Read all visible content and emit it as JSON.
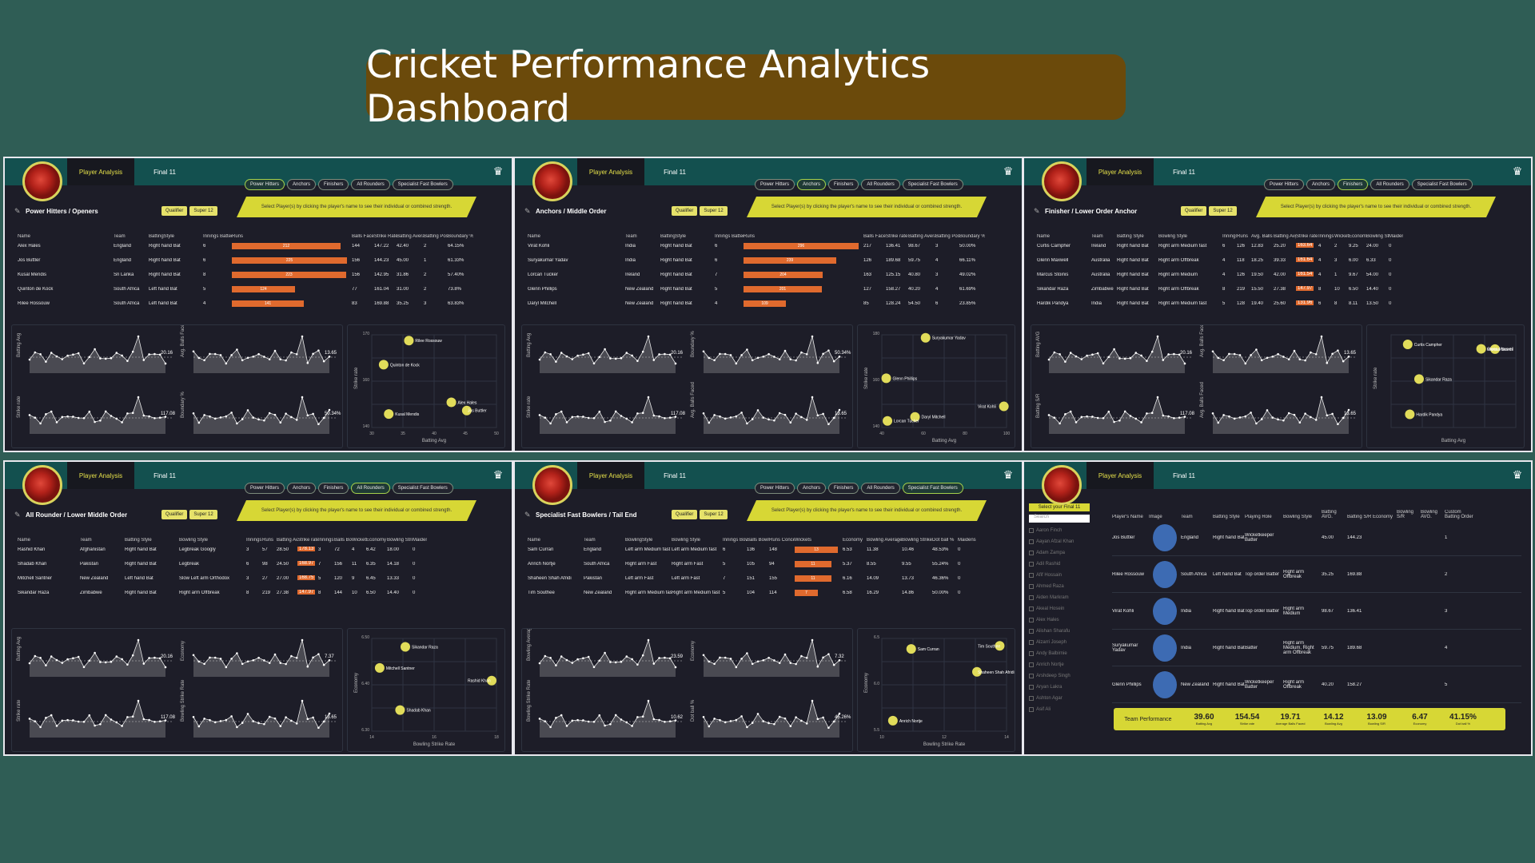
{
  "title": "Cricket Performance Analytics Dashboard",
  "common": {
    "player_analysis": "Player Analysis",
    "final11": "Final 11",
    "tabs": [
      "Power Hitters",
      "Anchors",
      "Finishers",
      "All Rounders",
      "Specialist Fast Bowlers"
    ],
    "qualifier": "Qualifier",
    "super": "Super 12",
    "banner": "Select Player(s) by clicking the player's name to see their individual or combined strength."
  },
  "p1": {
    "section": "Power Hitters / Openers",
    "cols": [
      "Name",
      "Team",
      "BattingStyle",
      "Innings Batted",
      "Runs",
      "Balls Faced",
      "Strike Rate",
      "Batting Average",
      "Batting Position",
      "Boundary %"
    ],
    "rows": [
      [
        "Alex Hales",
        "England",
        "Right hand Bat",
        "6",
        "212",
        "144",
        "147.22",
        "42.40",
        "2",
        "64.15%"
      ],
      [
        "Jos Buttler",
        "England",
        "Right hand Bat",
        "6",
        "225",
        "156",
        "144.23",
        "45.00",
        "1",
        "61.33%"
      ],
      [
        "Kusal Mendis",
        "Sri Lanka",
        "Right hand Bat",
        "8",
        "223",
        "156",
        "142.95",
        "31.86",
        "2",
        "57.40%"
      ],
      [
        "Quinton de Kock",
        "South Africa",
        "Left hand Bat",
        "5",
        "124",
        "77",
        "161.04",
        "31.00",
        "2",
        "73.8%"
      ],
      [
        "Rilee Rossouw",
        "South Africa",
        "Left hand Bat",
        "4",
        "141",
        "83",
        "169.88",
        "35.25",
        "3",
        "63.83%"
      ]
    ],
    "bars": [
      212,
      225,
      223,
      124,
      141
    ],
    "sp_labels": [
      "Batting Avg",
      "Avg. Balls Faced",
      "Strike rate",
      "Boundary %"
    ],
    "sp_ends": [
      "20.16",
      "13.65",
      "117.08",
      "50.34%"
    ],
    "scatter": {
      "ylabel": "Strike rate",
      "xlabel": "Batting Avg",
      "ticks_x": [
        "30",
        "35",
        "40",
        "45",
        "50"
      ],
      "ticks_y": [
        "140",
        "160",
        "170"
      ],
      "points": [
        {
          "n": "Rilee Rossouw",
          "x": 35.25,
          "y": 169.88
        },
        {
          "n": "Quinton de Kock",
          "x": 31.0,
          "y": 161.04
        },
        {
          "n": "Kusal Mendis",
          "x": 31.86,
          "y": 142.95
        },
        {
          "n": "Alex Hales",
          "x": 42.4,
          "y": 147.22
        },
        {
          "n": "Jos Buttler",
          "x": 45.0,
          "y": 144.23
        }
      ],
      "xmin": 29,
      "xmax": 50,
      "ymin": 138,
      "ymax": 172
    }
  },
  "p2": {
    "section": "Anchors / Middle Order",
    "cols": [
      "Name",
      "Team",
      "BattingStyle",
      "Innings Batted",
      "Runs",
      "Balls Faced",
      "Strike rate",
      "Batting Average",
      "Batting Position",
      "Boundary %"
    ],
    "rows": [
      [
        "Virat Kohli",
        "India",
        "Right hand Bat",
        "6",
        "296",
        "217",
        "136.41",
        "98.67",
        "3",
        "50.00%"
      ],
      [
        "Suryakumar Yadav",
        "India",
        "Right hand Bat",
        "6",
        "239",
        "126",
        "189.68",
        "59.75",
        "4",
        "66.11%"
      ],
      [
        "Lorcan Tucker",
        "Ireland",
        "Right hand Bat",
        "7",
        "204",
        "163",
        "125.15",
        "40.80",
        "3",
        "49.02%"
      ],
      [
        "Glenn Phillips",
        "New Zealand",
        "Right hand Bat",
        "5",
        "201",
        "127",
        "158.27",
        "40.20",
        "4",
        "61.69%"
      ],
      [
        "Daryl Mitchell",
        "New Zealand",
        "Right hand Bat",
        "4",
        "109",
        "85",
        "128.24",
        "54.50",
        "6",
        "23.85%"
      ]
    ],
    "bars": [
      296,
      239,
      204,
      201,
      109
    ],
    "sp_labels": [
      "Batting Avg",
      "Boundary %",
      "Strike rate",
      "Avg. Balls Faced"
    ],
    "sp_ends": [
      "20.16",
      "50.34%",
      "117.08",
      "13.65"
    ],
    "scatter": {
      "ylabel": "Strike rate",
      "xlabel": "Batting Avg",
      "ticks_x": [
        "40",
        "60",
        "80",
        "100"
      ],
      "ticks_y": [
        "140",
        "160",
        "180"
      ],
      "points": [
        {
          "n": "Suryakumar Yadav",
          "x": 59.75,
          "y": 189.68
        },
        {
          "n": "Glenn Phillips",
          "x": 40.2,
          "y": 158.27
        },
        {
          "n": "Daryl Mitchell",
          "x": 54.5,
          "y": 128.24
        },
        {
          "n": "Lorcan Tucker",
          "x": 40.8,
          "y": 125.15
        },
        {
          "n": "Virat Kohli",
          "x": 98.67,
          "y": 136.41
        }
      ],
      "xmin": 38,
      "xmax": 100,
      "ymin": 120,
      "ymax": 192
    }
  },
  "p3": {
    "section": "Finisher / Lower Order Anchor",
    "cols": [
      "Name",
      "Team",
      "Batting Style",
      "Bowling Style",
      "Innings Batting",
      "Runs",
      "Avg. Balls Faced",
      "Batting Avg",
      "Strike rate",
      "Innings Bowled",
      "Wickets",
      "Economy",
      "Bowling Strike Rate",
      "Maidens"
    ],
    "rows": [
      [
        "Curtis Campher",
        "Ireland",
        "Right hand Bat",
        "Right arm Medium fast",
        "6",
        "126",
        "12.83",
        "25.20",
        "163.64",
        "4",
        "2",
        "9.25",
        "24.00",
        "0"
      ],
      [
        "Glenn Maxwell",
        "Australia",
        "Right hand Bat",
        "Right arm Offbreak",
        "4",
        "118",
        "18.25",
        "39.33",
        "161.64",
        "4",
        "3",
        "6.00",
        "6.33",
        "0"
      ],
      [
        "Marcus Stoinis",
        "Australia",
        "Right hand Bat",
        "Right arm Medium",
        "4",
        "126",
        "19.50",
        "42.00",
        "161.54",
        "4",
        "1",
        "9.67",
        "54.00",
        "0"
      ],
      [
        "Sikandar Raza",
        "Zimbabwe",
        "Right hand Bat",
        "Right arm Offbreak",
        "8",
        "219",
        "15.50",
        "27.38",
        "147.97",
        "8",
        "10",
        "6.50",
        "14.40",
        "0"
      ],
      [
        "Hardik Pandya",
        "India",
        "Right hand Bat",
        "Right arm Medium fast",
        "5",
        "128",
        "19.40",
        "25.60",
        "131.96",
        "6",
        "8",
        "8.11",
        "13.50",
        "0"
      ]
    ],
    "sp_labels": [
      "Batting AVG",
      "Avg. Balls Faced",
      "Batting S/R",
      "Avg. Balls Faced"
    ],
    "sp_ends": [
      "20.16",
      "13.65",
      "117.08",
      "13.65"
    ],
    "scatter": {
      "ylabel": "Strike rate",
      "xlabel": "Batting Avg",
      "ticks_x": [],
      "ticks_y": [],
      "points": [
        {
          "n": "Curtis Campher",
          "x": 25.2,
          "y": 163.64
        },
        {
          "n": "Marcus Stoinis",
          "x": 42.0,
          "y": 161.54
        },
        {
          "n": "Glenn Maxwell",
          "x": 39.33,
          "y": 161.64
        },
        {
          "n": "Sikandar Raza",
          "x": 27.38,
          "y": 147.97
        },
        {
          "n": "Hardik Pandya",
          "x": 25.6,
          "y": 131.96
        }
      ],
      "xmin": 22,
      "xmax": 46,
      "ymin": 126,
      "ymax": 168
    }
  },
  "p4": {
    "section": "All Rounder / Lower Middle Order",
    "cols": [
      "Name",
      "Team",
      "Batting Style",
      "Bowling Style",
      "Innings Batted",
      "Runs",
      "Batting Avg",
      "Strike rate",
      "Innings Bowled",
      "Balls Bowled",
      "Wickets",
      "Economy",
      "Bowling Strike Rate",
      "Maidens"
    ],
    "rows": [
      [
        "Rashid Khan",
        "Afghanistan",
        "Right hand Bat",
        "Legbreak Googly",
        "3",
        "57",
        "28.50",
        "178.13",
        "3",
        "72",
        "4",
        "6.42",
        "18.00",
        "0"
      ],
      [
        "Shadab Khan",
        "Pakistan",
        "Right hand Bat",
        "Legbreak",
        "6",
        "98",
        "24.50",
        "168.97",
        "7",
        "156",
        "11",
        "6.35",
        "14.18",
        "0"
      ],
      [
        "Mitchell Santner",
        "New Zealand",
        "Left hand Bat",
        "Slow Left arm Orthodox",
        "3",
        "27",
        "27.00",
        "168.75",
        "5",
        "120",
        "9",
        "6.45",
        "13.33",
        "0"
      ],
      [
        "Sikandar Raza",
        "Zimbabwe",
        "Right hand Bat",
        "Right arm Offbreak",
        "8",
        "219",
        "27.38",
        "147.97",
        "8",
        "144",
        "10",
        "6.50",
        "14.40",
        "0"
      ]
    ],
    "sp_labels": [
      "Batting Avg",
      "Economy",
      "Strike rate",
      "Bowling Strike Rate"
    ],
    "sp_ends": [
      "20.16",
      "7.37",
      "117.08",
      "13.65"
    ],
    "scatter": {
      "ylabel": "Economy",
      "xlabel": "Bowling Strike Rate",
      "ticks_x": [
        "14",
        "16",
        "18"
      ],
      "ticks_y": [
        "6.30",
        "6.40",
        "6.50"
      ],
      "points": [
        {
          "n": "Sikandar Raza",
          "x": 14.4,
          "y": 6.5
        },
        {
          "n": "Mitchell Santner",
          "x": 13.33,
          "y": 6.45
        },
        {
          "n": "Rashid Khan",
          "x": 18.0,
          "y": 6.42
        },
        {
          "n": "Shadab Khan",
          "x": 14.18,
          "y": 6.35
        }
      ],
      "xmin": 13,
      "xmax": 18.2,
      "ymin": 6.3,
      "ymax": 6.52
    }
  },
  "p5": {
    "section": "Specialist Fast Bowlers / Tail End",
    "cols": [
      "Name",
      "Team",
      "BowlingStyle",
      "Bowling Style",
      "Innings Bowled",
      "Balls Bowled",
      "Runs Conceded",
      "Wickets",
      "Economy",
      "Bowling Average",
      "Bowling Strike Rate",
      "Dot ball %",
      "Maidens"
    ],
    "rows": [
      [
        "Sam Curran",
        "England",
        "Left arm Medium fast",
        "Left arm Medium fast",
        "6",
        "136",
        "148",
        "13",
        "6.53",
        "11.38",
        "10.46",
        "48.53%",
        "0"
      ],
      [
        "Anrich Nortje",
        "South Africa",
        "Right arm Fast",
        "Right arm Fast",
        "5",
        "105",
        "94",
        "11",
        "5.37",
        "8.55",
        "9.55",
        "55.24%",
        "0"
      ],
      [
        "Shaheen Shah Afridi",
        "Pakistan",
        "Left arm Fast",
        "Left arm Fast",
        "7",
        "151",
        "155",
        "11",
        "6.16",
        "14.09",
        "13.73",
        "46.36%",
        "0"
      ],
      [
        "Tim Southee",
        "New Zealand",
        "Right arm Medium fast",
        "Right arm Medium fast",
        "5",
        "104",
        "114",
        "7",
        "6.58",
        "16.29",
        "14.86",
        "50.00%",
        "0"
      ]
    ],
    "bars": [
      13,
      11,
      11,
      7
    ],
    "sp_labels": [
      "Bowling Average",
      "Economy",
      "Bowling Strike Rate",
      "Dot ball %"
    ],
    "sp_ends": [
      "23.59",
      "7.32",
      "10.62",
      "45.26%"
    ],
    "scatter": {
      "ylabel": "Economy",
      "xlabel": "Bowling Strike Rate",
      "ticks_x": [
        "10",
        "12",
        "14"
      ],
      "ticks_y": [
        "5.5",
        "6.0",
        "6.5"
      ],
      "points": [
        {
          "n": "Sam Curran",
          "x": 10.46,
          "y": 6.53
        },
        {
          "n": "Tim Southee",
          "x": 14.86,
          "y": 6.58
        },
        {
          "n": "Shaheen Shah Afridi",
          "x": 13.73,
          "y": 6.16
        },
        {
          "n": "Anrich Nortje",
          "x": 9.55,
          "y": 5.37
        }
      ],
      "xmin": 9,
      "xmax": 15.2,
      "ymin": 5.2,
      "ymax": 6.7
    }
  },
  "p6": {
    "select": "Select your Final 11",
    "search": "Search",
    "players": [
      "Aaron Finch",
      "Aayan Afzal Khan",
      "Adam Zampa",
      "Adil Rashid",
      "Afif Hossain",
      "Ahmed Raza",
      "Aiden Markram",
      "Akeal Hosein",
      "Alex Hales",
      "Alishan Sharafu",
      "Alzarri Joseph",
      "Andy Balbirnie",
      "Anrich Nortje",
      "Arshdeep Singh",
      "Aryan Lakra",
      "Ashton Agar",
      "Asif Ali"
    ],
    "cols": [
      "Player's Name",
      "Image",
      "Team",
      "Batting Style",
      "Playing Role",
      "Bowling Style",
      "Batting AVG.",
      "Batting S/R",
      "Economy",
      "Bowling S/R",
      "Bowling AVG.",
      "Custom Batting Order"
    ],
    "rows": [
      [
        "Jos Buttler",
        "",
        "England",
        "Right hand Bat",
        "Wicketkeeper Batter",
        "",
        "45.00",
        "144.23",
        "",
        "",
        "",
        "1"
      ],
      [
        "Rilee Rossouw",
        "",
        "South Africa",
        "Left hand Bat",
        "Top order Batter",
        "Right arm Offbreak",
        "35.25",
        "169.88",
        "",
        "",
        "",
        "2"
      ],
      [
        "Virat Kohli",
        "",
        "India",
        "Right hand Bat",
        "Top order Batter",
        "Right arm Medium",
        "98.67",
        "136.41",
        "",
        "",
        "",
        "3"
      ],
      [
        "Suryakumar Yadav",
        "",
        "India",
        "Right hand Bat",
        "Batter",
        "Right arm Medium, Right arm Offbreak",
        "59.75",
        "189.68",
        "",
        "",
        "",
        "4"
      ],
      [
        "Glenn Phillips",
        "",
        "New Zealand",
        "Right hand Bat",
        "Wicketkeeper Batter",
        "Right arm Offbreak",
        "40.20",
        "158.27",
        "",
        "",
        "",
        "5"
      ]
    ],
    "team_label": "Team Performance",
    "kpis": [
      {
        "v": "39.60",
        "l": "Batting Avg"
      },
      {
        "v": "154.54",
        "l": "Strike rate"
      },
      {
        "v": "19.71",
        "l": "Average Balls Faced"
      },
      {
        "v": "14.12",
        "l": "Bowling Avg"
      },
      {
        "v": "13.09",
        "l": "Bowling S/R"
      },
      {
        "v": "6.47",
        "l": "Economy"
      },
      {
        "v": "41.15%",
        "l": "Dot ball %"
      }
    ]
  }
}
